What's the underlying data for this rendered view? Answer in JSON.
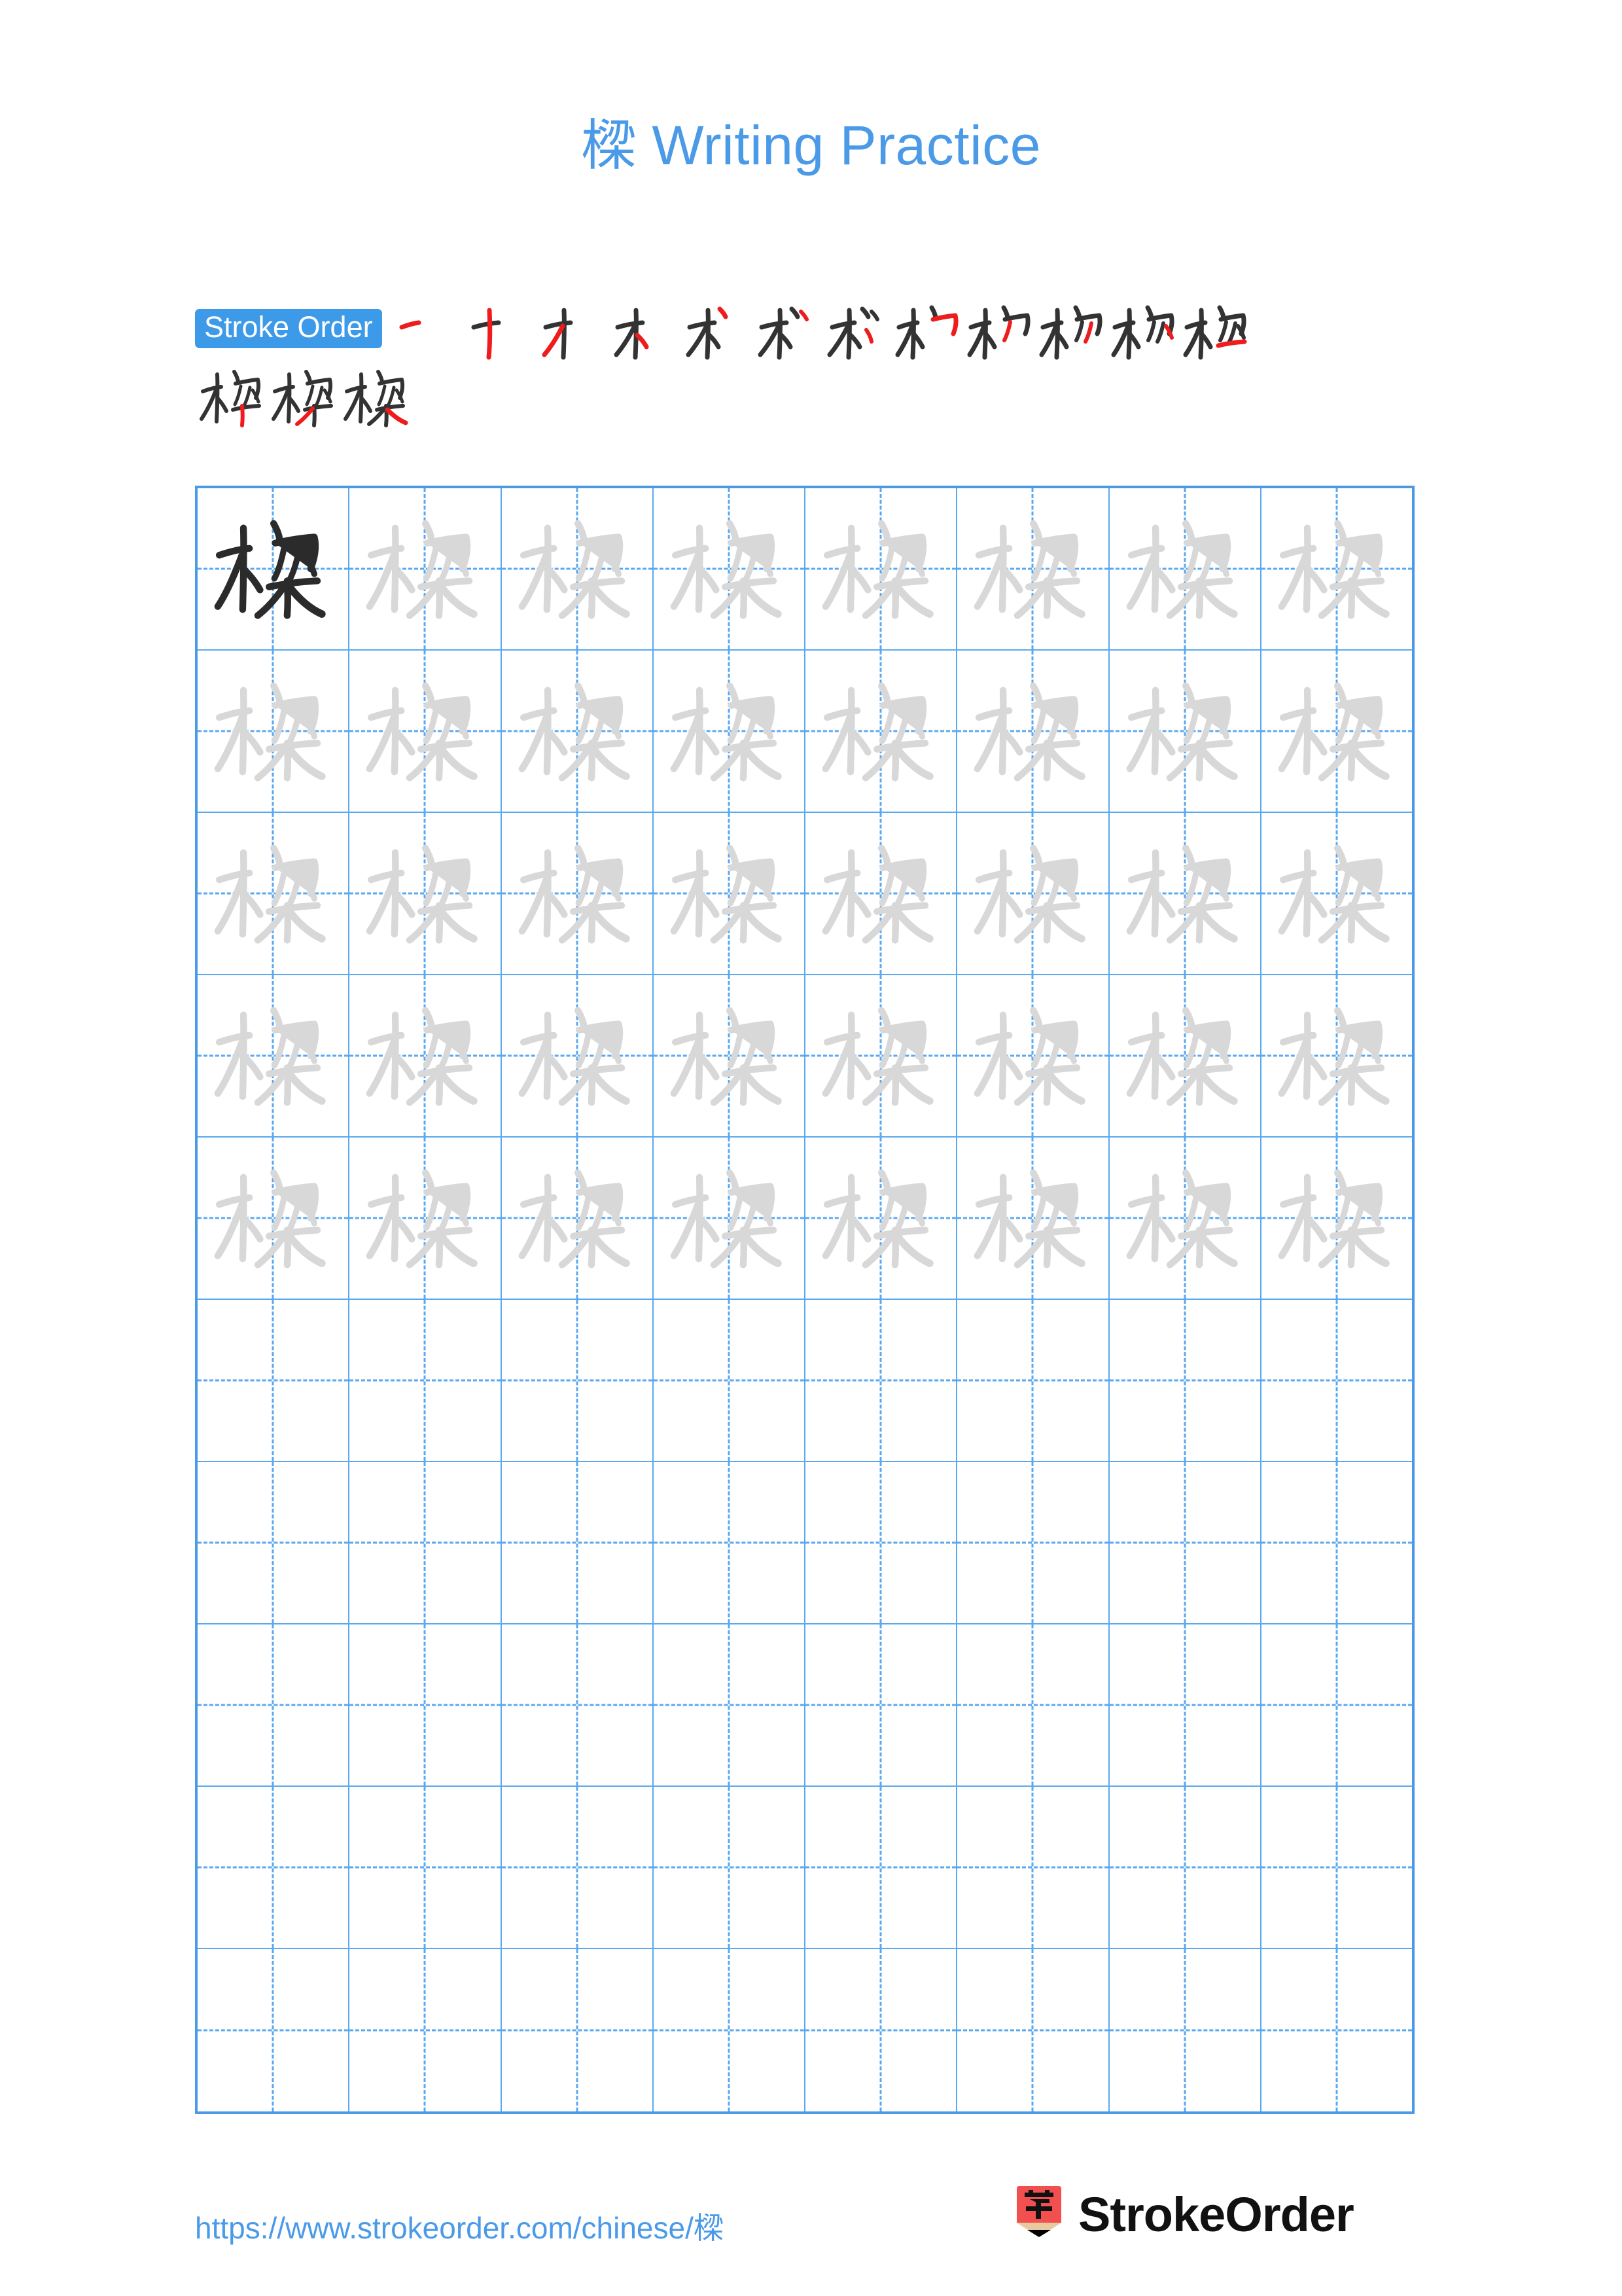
{
  "character": "樑",
  "title": "樑 Writing Practice",
  "title_character": "樑",
  "title_suffix": " Writing Practice",
  "colors": {
    "accent_blue": "#4a9ae8",
    "grid_blue": "#5aa8ef",
    "badge_blue": "#3d9ae8",
    "stroke_new_red": "#ee1c1c",
    "stroke_done_dark": "#333333",
    "trace_gray": "#d8d8d8",
    "ink_dark": "#2b2b2b",
    "logo_red": "#f25050",
    "logo_wood": "#e8c9a0"
  },
  "stroke_order": {
    "badge_label": "Stroke Order",
    "total_strokes": 15,
    "steps_row1": 12,
    "steps_row2": 3,
    "stroke_names": [
      "heng",
      "shu",
      "pie",
      "dian",
      "dian",
      "pie",
      "dian",
      "hengzhegou",
      "dian",
      "pie",
      "dian",
      "heng",
      "shu",
      "pie",
      "na"
    ]
  },
  "practice_grid": {
    "columns": 8,
    "rows": 10,
    "model_cell": {
      "row": 1,
      "column": 1,
      "style": "dark"
    },
    "trace_rows": 5,
    "blank_rows": 5,
    "guide_lines": "dashed-cross"
  },
  "footer": {
    "url_prefix": "https://www.strokeorder.com/chinese/",
    "url_character": "樑",
    "url_full": "https://www.strokeorder.com/chinese/樑",
    "brand_name": "StrokeOrder",
    "brand_mark_character": "字"
  }
}
